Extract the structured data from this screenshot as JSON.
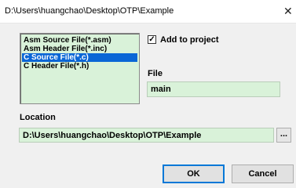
{
  "window": {
    "title": "D:\\Users\\huangchao\\Desktop\\OTP\\Example",
    "close_glyph": "✕"
  },
  "file_types": {
    "items": [
      {
        "label": "Asm Source File(*.asm)",
        "selected": false
      },
      {
        "label": "Asm Header File(*.inc)",
        "selected": false
      },
      {
        "label": "C Source File(*.c)",
        "selected": true
      },
      {
        "label": "C Header File(*.h)",
        "selected": false
      }
    ]
  },
  "add_to_project": {
    "label": "Add to project",
    "checked": true,
    "check_glyph": "✓"
  },
  "file": {
    "label": "File",
    "value": "main"
  },
  "location": {
    "label": "Location",
    "value": "D:\\Users\\huangchao\\Desktop\\OTP\\Example",
    "browse_label": "..."
  },
  "buttons": {
    "ok": "OK",
    "cancel": "Cancel"
  },
  "colors": {
    "field_background": "#d9f2d9",
    "selection": "#0a66d6",
    "dialog_background": "#f0f0f0"
  }
}
